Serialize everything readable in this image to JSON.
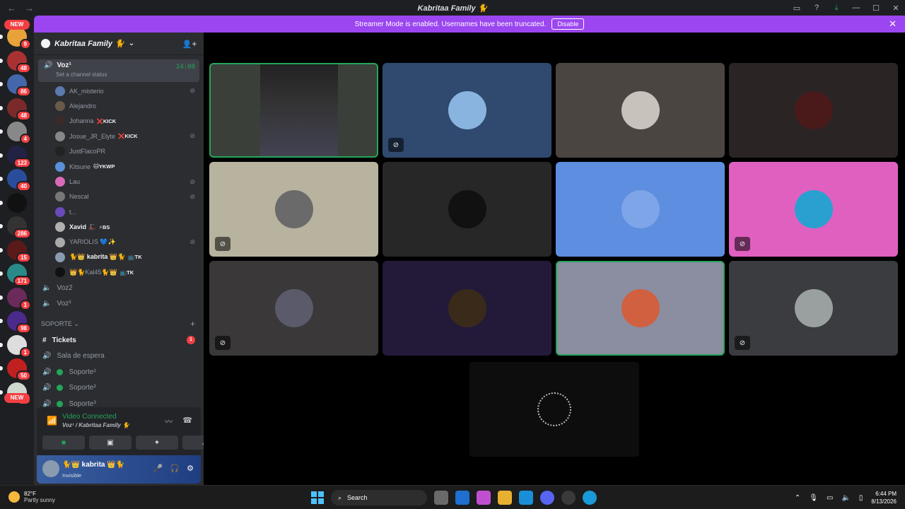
{
  "window": {
    "title": "Kabritaa Family 🐈",
    "back": "←",
    "forward": "→"
  },
  "banner": {
    "text": "Streamer Mode is enabled. Usernames have been truncated.",
    "button": "Disable",
    "close": "✕"
  },
  "rail": {
    "new_top": "NEW",
    "new_bottom": "NEW",
    "servers": [
      {
        "badge": "9",
        "color": "#e8a23a"
      },
      {
        "badge": "48",
        "color": "#a83232"
      },
      {
        "badge": "86",
        "color": "#4466aa"
      },
      {
        "badge": "48",
        "color": "#7a2a2a"
      },
      {
        "badge": "4",
        "color": "#888888"
      },
      {
        "badge": "123",
        "color": "#222244"
      },
      {
        "badge": "40",
        "color": "#2a4d9b"
      },
      {
        "badge": "",
        "color": "#111111"
      },
      {
        "badge": "286",
        "color": "#333333"
      },
      {
        "badge": "15",
        "color": "#5a1a1a"
      },
      {
        "badge": "171",
        "color": "#2a8a8a"
      },
      {
        "badge": "1",
        "color": "#6a2a5a"
      },
      {
        "badge": "98",
        "color": "#4a2a8a"
      },
      {
        "badge": "1",
        "color": "#dddddd"
      },
      {
        "badge": "50",
        "color": "#c02020"
      },
      {
        "badge": "13",
        "color": "#cfd8cf"
      }
    ]
  },
  "sidebar": {
    "server_name": "Kabritaa Family 🐈",
    "active_channel": {
      "name": "Voz¹",
      "status": "Set a channel status",
      "time": "24:00"
    },
    "members": [
      {
        "name": "AK_misterio",
        "tag": "",
        "muted": true,
        "bold": false,
        "color": "#5a7ab0"
      },
      {
        "name": "Alejandro",
        "tag": "",
        "muted": false,
        "bold": false,
        "color": "#6a5a4a"
      },
      {
        "name": "Johanna",
        "tag": "❌KICK",
        "muted": false,
        "bold": false,
        "color": "#3a2a2a"
      },
      {
        "name": "Josue_JR_Elyte",
        "tag": "❌KICK",
        "muted": true,
        "bold": false,
        "color": "#888888"
      },
      {
        "name": "JustFlacoPR",
        "tag": "",
        "muted": false,
        "bold": false,
        "color": "#222222"
      },
      {
        "name": "Kitsune",
        "tag": "🐱YKWP",
        "muted": false,
        "bold": false,
        "color": "#5b8fd8"
      },
      {
        "name": "Lau",
        "tag": "",
        "muted": true,
        "bold": false,
        "color": "#d86ab8"
      },
      {
        "name": "Nescal",
        "tag": "",
        "muted": true,
        "bold": false,
        "color": "#777777"
      },
      {
        "name": "t...",
        "tag": "",
        "muted": false,
        "bold": false,
        "color": "#6a4ab8"
      },
      {
        "name": "Xavid 🎩",
        "tag": "⚡BS",
        "muted": false,
        "bold": true,
        "color": "#b0b0b0"
      },
      {
        "name": "YARIOLIS 💙✨",
        "tag": "",
        "muted": true,
        "bold": false,
        "color": "#aaaaaa"
      },
      {
        "name": "🐈👑 kabrita 👑🐈",
        "tag": "📺TK",
        "muted": false,
        "bold": true,
        "color": "#8a9bb0"
      },
      {
        "name": "👑🐈Kal45🐈👑",
        "tag": "📺TK",
        "muted": false,
        "bold": false,
        "color": "#111111"
      }
    ],
    "voice_channels": [
      "Voz2",
      "Voz³"
    ],
    "category": "SOPORTE",
    "support_channels": [
      {
        "name": "Tickets",
        "bold": true,
        "icon": "#",
        "badge": "1"
      },
      {
        "name": "Sala de espera",
        "bold": false,
        "icon": "🔊",
        "badge": ""
      },
      {
        "name": "Soporte¹",
        "bold": false,
        "icon": "🔊",
        "badge": ""
      },
      {
        "name": "Soporte²",
        "bold": false,
        "icon": "🔊",
        "badge": ""
      },
      {
        "name": "Soporte³",
        "bold": false,
        "icon": "🔊",
        "badge": ""
      }
    ],
    "voice_panel": {
      "status": "Video Connected",
      "location": "Voz¹ / Kabritaa Family 🐈"
    },
    "user": {
      "name": "🐈👑 kabrita 👑🐈",
      "status": "Invisible"
    }
  },
  "tiles": [
    {
      "bg": "#3a3f3a",
      "pfp": "",
      "muted": false,
      "selected": true
    },
    {
      "bg": "#2f4a6e",
      "pfp": "#8ab4e0",
      "muted": true,
      "selected": false
    },
    {
      "bg": "#4a4540",
      "pfp": "#c8c2bc",
      "muted": false,
      "selected": false
    },
    {
      "bg": "#2b2424",
      "pfp": "#4a1a1a",
      "muted": false,
      "selected": false
    },
    {
      "bg": "#b8b39e",
      "pfp": "#6a6a6a",
      "muted": true,
      "selected": false
    },
    {
      "bg": "#272727",
      "pfp": "#111111",
      "muted": false,
      "selected": false
    },
    {
      "bg": "#5d8ee0",
      "pfp": "#7ea5e8",
      "muted": false,
      "selected": false
    },
    {
      "bg": "#e060c0",
      "pfp": "#2aa0d0",
      "muted": true,
      "selected": false
    },
    {
      "bg": "#3a3838",
      "pfp": "#5a5a6a",
      "muted": true,
      "selected": false
    },
    {
      "bg": "#231a3a",
      "pfp": "#3a2a1a",
      "muted": false,
      "selected": false
    },
    {
      "bg": "#8a8ea0",
      "pfp": "#d06040",
      "muted": false,
      "selected": true
    },
    {
      "bg": "#3a3c3f",
      "pfp": "#9aa0a0",
      "muted": true,
      "selected": false
    }
  ],
  "taskbar": {
    "temp": "82°F",
    "weather": "Partly sunny",
    "search": "Search",
    "time": "6:44 PM",
    "date": "8/13/2026"
  }
}
